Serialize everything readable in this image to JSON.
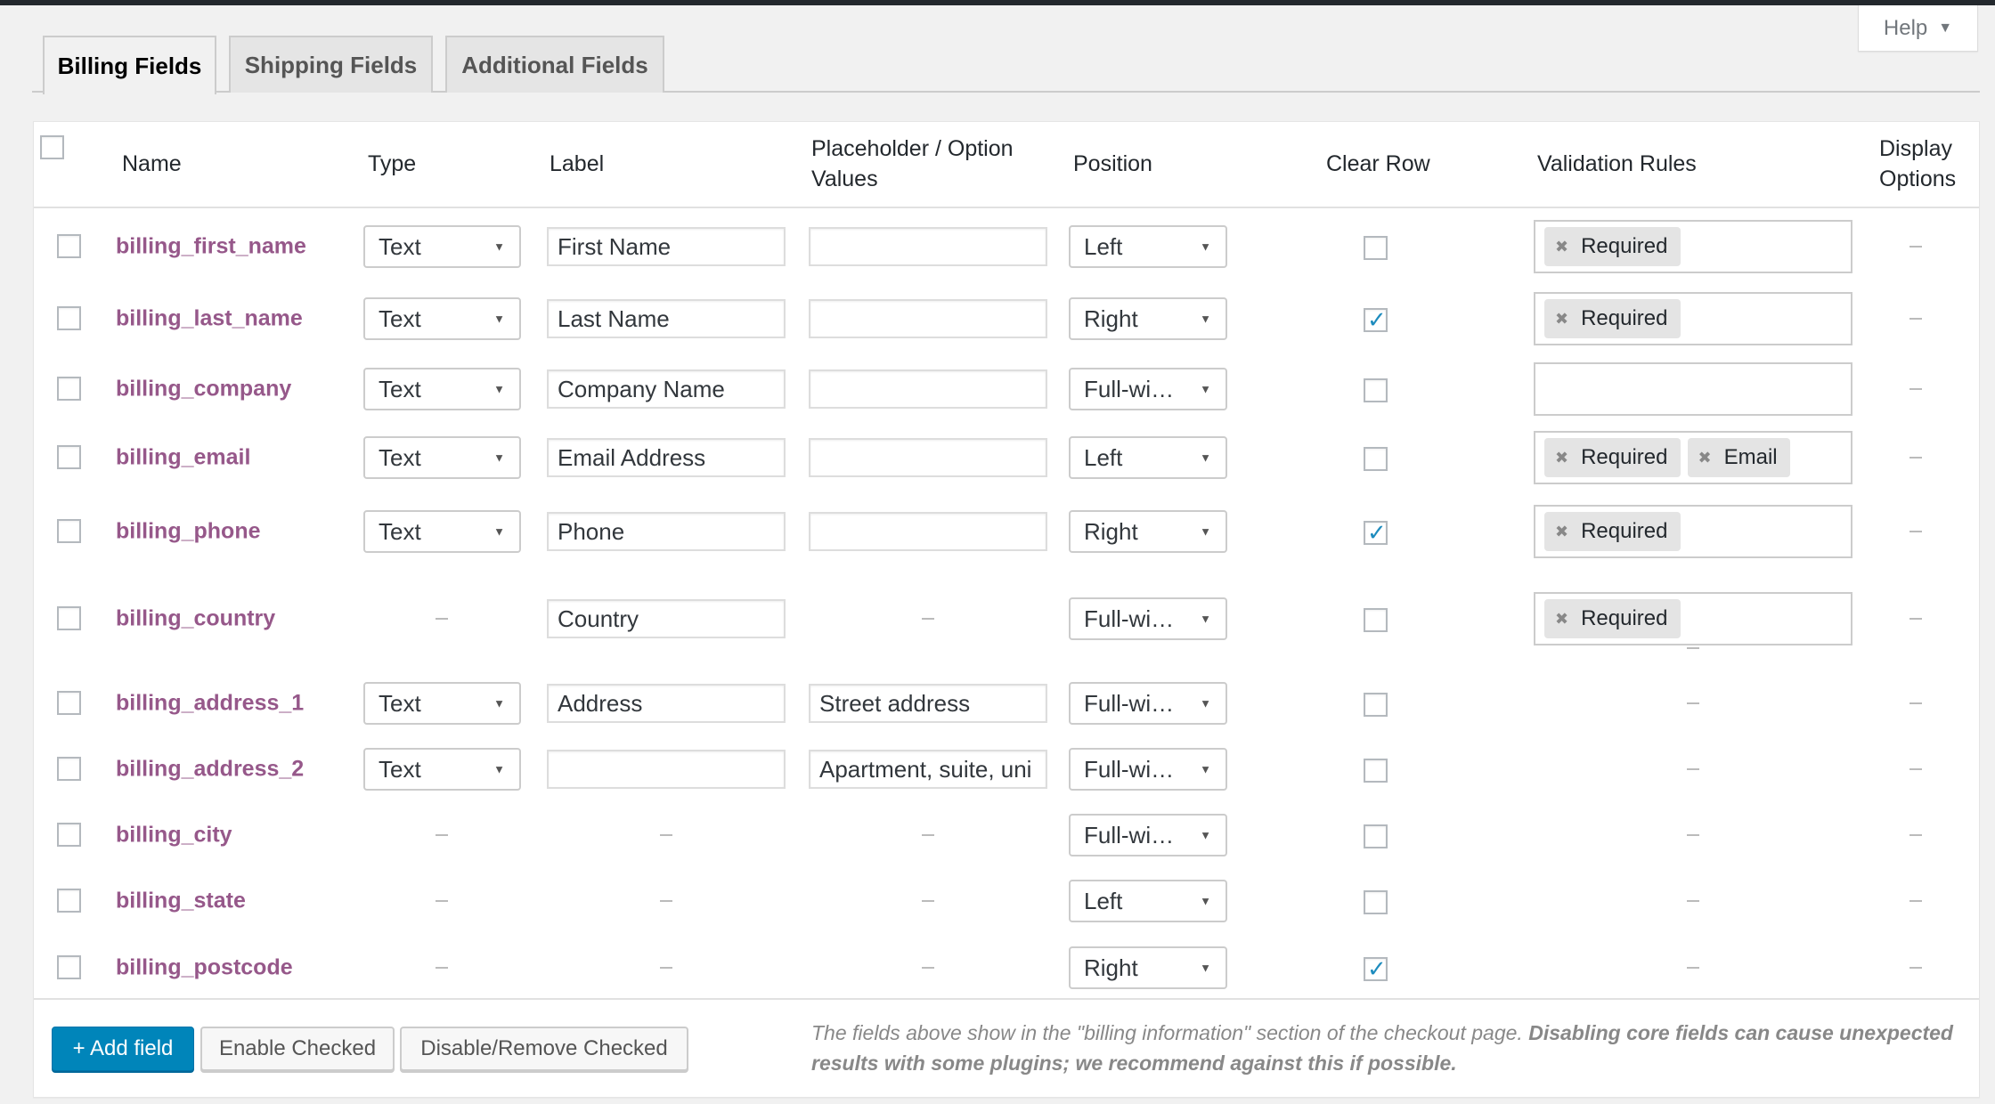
{
  "help": {
    "label": "Help",
    "icon": "triangle-down-icon"
  },
  "tabs": [
    {
      "label": "Billing Fields",
      "active": true
    },
    {
      "label": "Shipping Fields",
      "active": false
    },
    {
      "label": "Additional Fields",
      "active": false
    }
  ],
  "table": {
    "headers": {
      "name": "Name",
      "type": "Type",
      "label": "Label",
      "placeholder_line1": "Placeholder / Option",
      "placeholder_line2": "Values",
      "position": "Position",
      "clear_row": "Clear Row",
      "validation": "Validation Rules",
      "display_line1": "Display",
      "display_line2": "Options"
    },
    "empty_marker": "–",
    "rows": [
      {
        "name": "billing_first_name",
        "type": "Text",
        "label": "First Name",
        "placeholder": "",
        "position": "Left",
        "clear_row": false,
        "validation": [
          "Required"
        ],
        "display": "–"
      },
      {
        "name": "billing_last_name",
        "type": "Text",
        "label": "Last Name",
        "placeholder": "",
        "position": "Right",
        "clear_row": true,
        "validation": [
          "Required"
        ],
        "display": "–"
      },
      {
        "name": "billing_company",
        "type": "Text",
        "label": "Company Name",
        "placeholder": "",
        "position": "Full-wi…",
        "clear_row": false,
        "validation": [],
        "display": "–"
      },
      {
        "name": "billing_email",
        "type": "Text",
        "label": "Email Address",
        "placeholder": "",
        "position": "Left",
        "clear_row": false,
        "validation": [
          "Required",
          "Email"
        ],
        "display": "–"
      },
      {
        "name": "billing_phone",
        "type": "Text",
        "label": "Phone",
        "placeholder": "",
        "position": "Right",
        "clear_row": true,
        "validation": [
          "Required"
        ],
        "display": "–"
      },
      {
        "name": "billing_country",
        "type": null,
        "label": "Country",
        "placeholder": null,
        "position": "Full-wi…",
        "clear_row": false,
        "validation": [
          "Required"
        ],
        "display": "–"
      },
      {
        "name": "billing_address_1",
        "type": "Text",
        "label": "Address",
        "placeholder": "Street address",
        "position": "Full-wi…",
        "clear_row": false,
        "validation": null,
        "display": "–"
      },
      {
        "name": "billing_address_2",
        "type": "Text",
        "label": "",
        "placeholder": "Apartment, suite, uni",
        "position": "Full-wi…",
        "clear_row": false,
        "validation": null,
        "display": "–"
      },
      {
        "name": "billing_city",
        "type": null,
        "label": null,
        "placeholder": null,
        "position": "Full-wi…",
        "clear_row": false,
        "validation": null,
        "display": "–"
      },
      {
        "name": "billing_state",
        "type": null,
        "label": null,
        "placeholder": null,
        "position": "Left",
        "clear_row": false,
        "validation": null,
        "display": "–"
      },
      {
        "name": "billing_postcode",
        "type": null,
        "label": null,
        "placeholder": null,
        "position": "Right",
        "clear_row": true,
        "validation": null,
        "display": "–"
      }
    ]
  },
  "footer": {
    "add_field": "+ Add field",
    "enable_checked": "Enable Checked",
    "disable_checked": "Disable/Remove Checked",
    "note_plain": "The fields above show in the \"billing information\" section of the checkout page. ",
    "note_bold": "Disabling core fields can cause unexpected results with some plugins; we recommend against this if possible."
  },
  "colors": {
    "field_name": "#96588a",
    "primary_button": "#0085ba",
    "checkmark": "#1e8cbe",
    "topbar": "#23282d",
    "background": "#f1f1f1"
  }
}
